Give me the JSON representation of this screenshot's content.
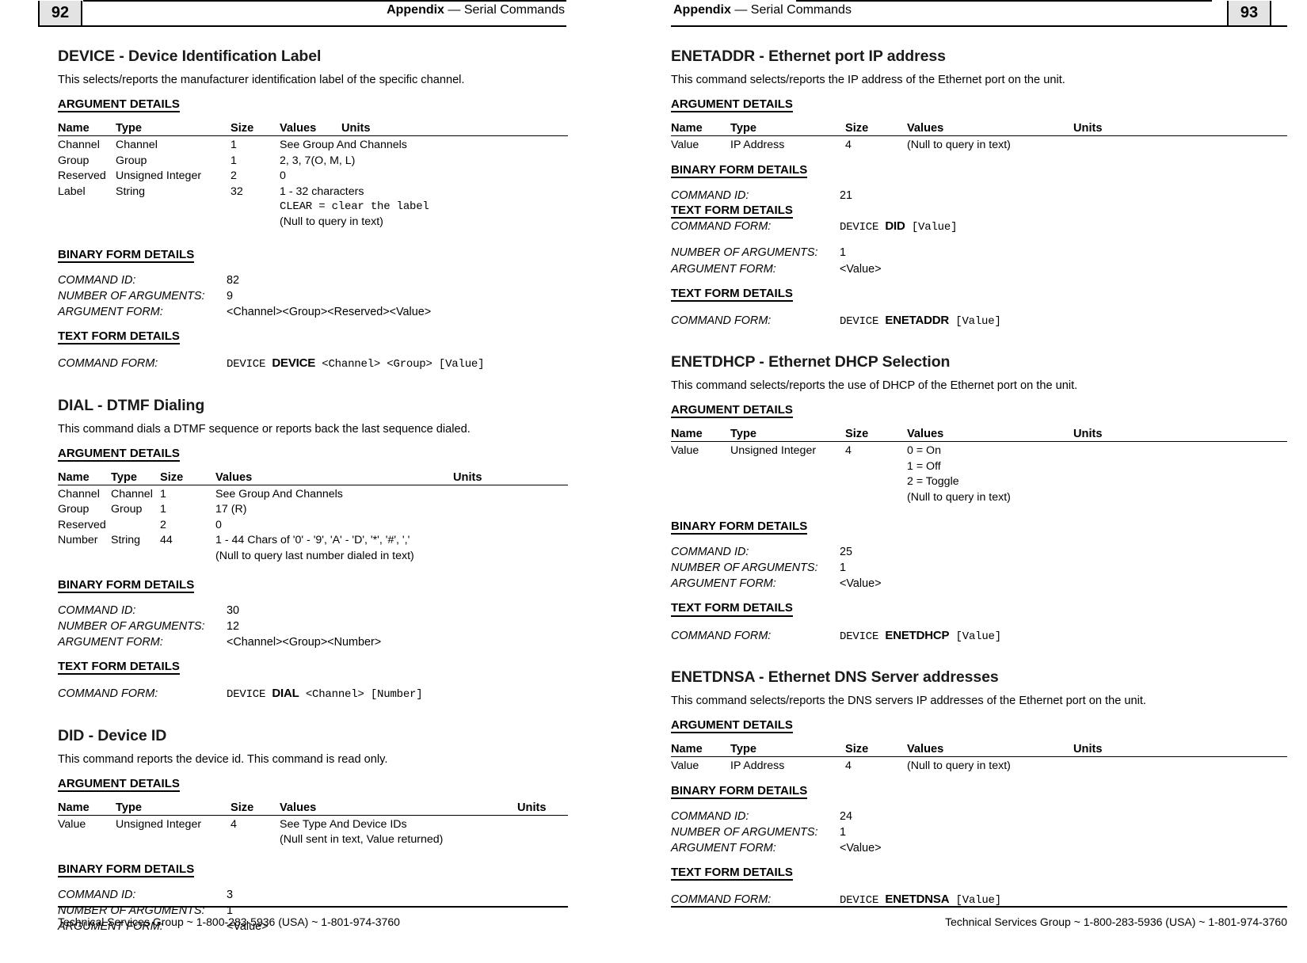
{
  "pages": [
    {
      "page_number": "92",
      "header": {
        "title": "Appendix",
        "separator": "—",
        "subtitle": "Serial Commands"
      },
      "footer": "Technical Services Group ~ 1-800-283-5936 (USA) ~ 1-801-974-3760",
      "sections": [
        {
          "heading": "DEVICE - Device Identification Label",
          "description": "This selects/reports the manufacturer identification label of the specific channel.",
          "argument_details_label": "ARGUMENT DETAILS",
          "table": {
            "columns": [
              "Name",
              "Type",
              "Size",
              "Values",
              "Units"
            ],
            "rows": [
              {
                "name": "Channel",
                "type": "Channel",
                "size": "1",
                "values": [
                  "See Group And Channels"
                ],
                "units": ""
              },
              {
                "name": "Group",
                "type": "Group",
                "size": "1",
                "values": [
                  "2, 3, 7(O, M, L)"
                ],
                "units": ""
              },
              {
                "name": "Reserved",
                "type": "Unsigned Integer",
                "size": "2",
                "values": [
                  "0"
                ],
                "units": ""
              },
              {
                "name": "Label",
                "type": "String",
                "size": "32",
                "values": [
                  "1 - 32 characters",
                  "CLEAR = clear the label",
                  "(Null to query in text)"
                ],
                "units": ""
              }
            ]
          },
          "binary_label": "BINARY FORM DETAILS",
          "binary": [
            {
              "label": "COMMAND ID:",
              "value": "82"
            },
            {
              "label": "NUMBER OF ARGUMENTS:",
              "value": "9"
            },
            {
              "label": "ARGUMENT FORM:",
              "value": "<Channel><Group><Reserved><Value>"
            }
          ],
          "text_label": "TEXT FORM DETAILS",
          "text_form": [
            {
              "label": "COMMAND FORM:",
              "prefix": "DEVICE ",
              "keyword": "DEVICE",
              "suffix": " <Channel> <Group> [Value]"
            }
          ]
        },
        {
          "heading": "DIAL - DTMF Dialing",
          "description": "This command dials a DTMF sequence or reports back the last sequence dialed.",
          "argument_details_label": "ARGUMENT DETAILS",
          "table": {
            "columns": [
              "Name",
              "Type",
              "Size",
              "Values",
              "Units"
            ],
            "rows": [
              {
                "name": "Channel",
                "type": "Channel",
                "size": "1",
                "values": [
                  "See Group And Channels"
                ],
                "units": ""
              },
              {
                "name": "Group",
                "type": "Group",
                "size": "1",
                "values": [
                  "17 (R)"
                ],
                "units": ""
              },
              {
                "name": "Reserved",
                "type": "",
                "size": "2",
                "values": [
                  "0"
                ],
                "units": ""
              },
              {
                "name": "Number",
                "type": "String",
                "size": "44",
                "values": [
                  "1 - 44 Chars of '0' - '9', 'A' - 'D', '*', '#', ','",
                  "(Null to query last number dialed in text)"
                ],
                "units": ""
              }
            ]
          },
          "binary_label": "BINARY FORM DETAILS",
          "binary": [
            {
              "label": "COMMAND ID:",
              "value": "30"
            },
            {
              "label": "NUMBER OF ARGUMENTS:",
              "value": "12"
            },
            {
              "label": "ARGUMENT FORM:",
              "value": "<Channel><Group><Number>"
            }
          ],
          "text_label": "TEXT FORM DETAILS",
          "text_form": [
            {
              "label": "COMMAND FORM:",
              "prefix": "DEVICE ",
              "keyword": "DIAL",
              "suffix": " <Channel> [Number]"
            }
          ]
        },
        {
          "heading": "DID - Device ID",
          "description": "This command reports the device id. This command is read only.",
          "argument_details_label": "ARGUMENT DETAILS",
          "table": {
            "columns": [
              "Name",
              "Type",
              "Size",
              "Values",
              "Units"
            ],
            "rows": [
              {
                "name": "Value",
                "type": "Unsigned Integer",
                "size": "4",
                "values": [
                  "See Type And Device IDs",
                  "(Null sent in text, Value returned)"
                ],
                "units": ""
              }
            ]
          },
          "binary_label": "BINARY FORM DETAILS",
          "binary": [
            {
              "label": "COMMAND ID:",
              "value": "3"
            },
            {
              "label": "NUMBER OF ARGUMENTS:",
              "value": "1"
            },
            {
              "label": "ARGUMENT FORM:",
              "value": "<Value>"
            }
          ],
          "text_label": "",
          "text_form": []
        }
      ]
    },
    {
      "page_number": "93",
      "header": {
        "title": "Appendix",
        "separator": "—",
        "subtitle": "Serial Commands"
      },
      "footer": "Technical Services Group ~ 1-800-283-5936 (USA) ~ 1-801-974-3760",
      "sections": [
        {
          "heading": "ENETADDR - Ethernet port IP address",
          "description": "This command selects/reports the IP address of the Ethernet port on the unit.",
          "argument_details_label": "ARGUMENT DETAILS",
          "table": {
            "columns": [
              "Name",
              "Type",
              "Size",
              "Values",
              "Units"
            ],
            "rows": [
              {
                "name": "Value",
                "type": "IP Address",
                "size": "4",
                "values": [
                  "(Null to query in text)"
                ],
                "units": ""
              }
            ]
          },
          "binary_label": "BINARY FORM DETAILS",
          "binary": [
            {
              "label": "COMMAND ID:",
              "value": "21"
            }
          ],
          "inline_text_label": "TEXT FORM DETAILS",
          "inline_text_form": [
            {
              "label": "COMMAND FORM:",
              "prefix": "DEVICE ",
              "keyword": "DID",
              "suffix": " [Value]"
            }
          ],
          "binary_cont": [
            {
              "label": "NUMBER OF ARGUMENTS:",
              "value": "1"
            },
            {
              "label": "ARGUMENT FORM:",
              "value": "<Value>"
            }
          ],
          "text_label": "TEXT FORM DETAILS",
          "text_form": [
            {
              "label": "COMMAND FORM:",
              "prefix": "DEVICE ",
              "keyword": "ENETADDR",
              "suffix": " [Value]"
            }
          ]
        },
        {
          "heading": "ENETDHCP - Ethernet DHCP Selection",
          "description": "This command selects/reports the use of DHCP of the Ethernet port on the unit.",
          "argument_details_label": "ARGUMENT DETAILS",
          "table": {
            "columns": [
              "Name",
              "Type",
              "Size",
              "Values",
              "Units"
            ],
            "rows": [
              {
                "name": "Value",
                "type": "Unsigned Integer",
                "size": "4",
                "values": [
                  "0 = On",
                  "1 = Off",
                  "2 = Toggle",
                  "(Null to query in text)"
                ],
                "units": ""
              }
            ]
          },
          "binary_label": "BINARY FORM DETAILS",
          "binary": [
            {
              "label": "COMMAND ID:",
              "value": "25"
            },
            {
              "label": "NUMBER OF ARGUMENTS:",
              "value": "1"
            },
            {
              "label": "ARGUMENT FORM:",
              "value": "<Value>"
            }
          ],
          "text_label": "TEXT FORM DETAILS",
          "text_form": [
            {
              "label": "COMMAND FORM:",
              "prefix": "DEVICE ",
              "keyword": "ENETDHCP",
              "suffix": " [Value]"
            }
          ]
        },
        {
          "heading": "ENETDNSA - Ethernet DNS Server addresses",
          "description": "This command selects/reports the DNS servers IP addresses of the Ethernet port on the unit.",
          "argument_details_label": "ARGUMENT DETAILS",
          "table": {
            "columns": [
              "Name",
              "Type",
              "Size",
              "Values",
              "Units"
            ],
            "rows": [
              {
                "name": "Value",
                "type": "IP Address",
                "size": "4",
                "values": [
                  "(Null to query in text)"
                ],
                "units": ""
              }
            ]
          },
          "binary_label": "BINARY FORM DETAILS",
          "binary": [
            {
              "label": "COMMAND ID:",
              "value": "24"
            },
            {
              "label": "NUMBER OF ARGUMENTS:",
              "value": "1"
            },
            {
              "label": "ARGUMENT FORM:",
              "value": "<Value>"
            }
          ],
          "text_label": "TEXT FORM DETAILS",
          "text_form": [
            {
              "label": "COMMAND FORM:",
              "prefix": "DEVICE ",
              "keyword": "ENETDNSA",
              "suffix": " [Value]"
            }
          ]
        }
      ]
    }
  ]
}
